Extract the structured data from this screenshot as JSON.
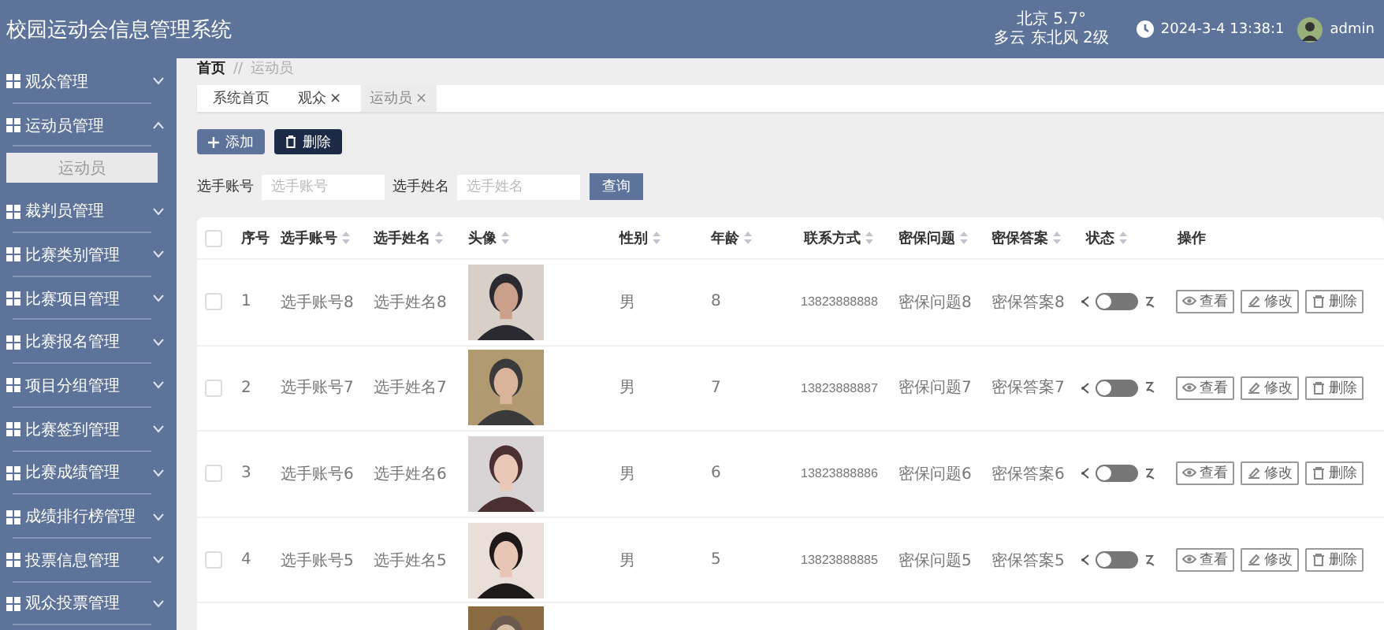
{
  "header": {
    "title": "校园运动会信息管理系统",
    "weather": {
      "city_temp": "北京 5.7°",
      "condition": "多云 东北风 2级"
    },
    "datetime": "2024-3-4 13:38:1",
    "user": "admin"
  },
  "sidebar": {
    "items": [
      {
        "label": "观众管理",
        "expanded": false
      },
      {
        "label": "运动员管理",
        "expanded": true,
        "children": [
          {
            "label": "运动员",
            "selected": true
          }
        ]
      },
      {
        "label": "裁判员管理",
        "expanded": false
      },
      {
        "label": "比赛类别管理",
        "expanded": false
      },
      {
        "label": "比赛项目管理",
        "expanded": false
      },
      {
        "label": "比赛报名管理",
        "expanded": false
      },
      {
        "label": "项目分组管理",
        "expanded": false
      },
      {
        "label": "比赛签到管理",
        "expanded": false
      },
      {
        "label": "比赛成绩管理",
        "expanded": false
      },
      {
        "label": "成绩排行榜管理",
        "expanded": false
      },
      {
        "label": "投票信息管理",
        "expanded": false
      },
      {
        "label": "观众投票管理",
        "expanded": false
      }
    ]
  },
  "breadcrumb": {
    "items": [
      "首页",
      "运动员"
    ],
    "separator": "//"
  },
  "tabs": [
    {
      "label": "系统首页",
      "selected": false
    },
    {
      "label": "观众",
      "close": "×",
      "selected": false
    },
    {
      "label": "运动员",
      "close": "×",
      "selected": true
    }
  ],
  "toolbar": {
    "buttons": [
      {
        "label": "添加",
        "kind": "add"
      },
      {
        "label": "删除",
        "kind": "delete"
      }
    ]
  },
  "search": {
    "fields": [
      {
        "label": "选手账号",
        "placeholder": "选手账号"
      },
      {
        "label": "选手姓名",
        "placeholder": "选手姓名"
      }
    ],
    "button": "查询"
  },
  "table": {
    "select_all_checked": false,
    "columns": [
      {
        "kind": "checkbox",
        "sortable": false
      },
      {
        "kind": "text",
        "label": "序号",
        "sortable": false
      },
      {
        "kind": "text",
        "label": "选手账号",
        "sortable": true
      },
      {
        "kind": "text",
        "label": "选手姓名",
        "sortable": true
      },
      {
        "kind": "text",
        "label": "头像",
        "sortable": true
      },
      {
        "kind": "text",
        "label": "性别",
        "sortable": true
      },
      {
        "kind": "text",
        "label": "年龄",
        "sortable": true
      },
      {
        "kind": "text",
        "label": "联系方式",
        "sortable": true
      },
      {
        "kind": "text",
        "label": "密保问题",
        "sortable": true
      },
      {
        "kind": "text",
        "label": "密保答案",
        "sortable": true
      },
      {
        "kind": "text",
        "label": "状态",
        "sortable": true
      },
      {
        "kind": "text",
        "label": "操作",
        "sortable": false
      }
    ],
    "rows": [
      {
        "checked": false,
        "index": "1",
        "account": "选手账号8",
        "name": "选手姓名8",
        "gender": "男",
        "age": "8",
        "phone": "13823888888",
        "question": "密保问题8",
        "answer": "密保答案8",
        "status_on": false,
        "actions": [
          {
            "label": "查看",
            "kind": "view"
          },
          {
            "label": "修改",
            "kind": "edit"
          },
          {
            "label": "删除",
            "kind": "delete"
          }
        ]
      },
      {
        "checked": false,
        "index": "2",
        "account": "选手账号7",
        "name": "选手姓名7",
        "gender": "男",
        "age": "7",
        "phone": "13823888887",
        "question": "密保问题7",
        "answer": "密保答案7",
        "status_on": false,
        "actions": [
          {
            "label": "查看",
            "kind": "view"
          },
          {
            "label": "修改",
            "kind": "edit"
          },
          {
            "label": "删除",
            "kind": "delete"
          }
        ]
      },
      {
        "checked": false,
        "index": "3",
        "account": "选手账号6",
        "name": "选手姓名6",
        "gender": "男",
        "age": "6",
        "phone": "13823888886",
        "question": "密保问题6",
        "answer": "密保答案6",
        "status_on": false,
        "actions": [
          {
            "label": "查看",
            "kind": "view"
          },
          {
            "label": "修改",
            "kind": "edit"
          },
          {
            "label": "删除",
            "kind": "delete"
          }
        ]
      },
      {
        "checked": false,
        "index": "4",
        "account": "选手账号5",
        "name": "选手姓名5",
        "gender": "男",
        "age": "5",
        "phone": "13823888885",
        "question": "密保问题5",
        "answer": "密保答案5",
        "status_on": false,
        "actions": [
          {
            "label": "查看",
            "kind": "view"
          },
          {
            "label": "修改",
            "kind": "edit"
          },
          {
            "label": "删除",
            "kind": "delete"
          }
        ]
      },
      {
        "partial": true
      }
    ]
  }
}
